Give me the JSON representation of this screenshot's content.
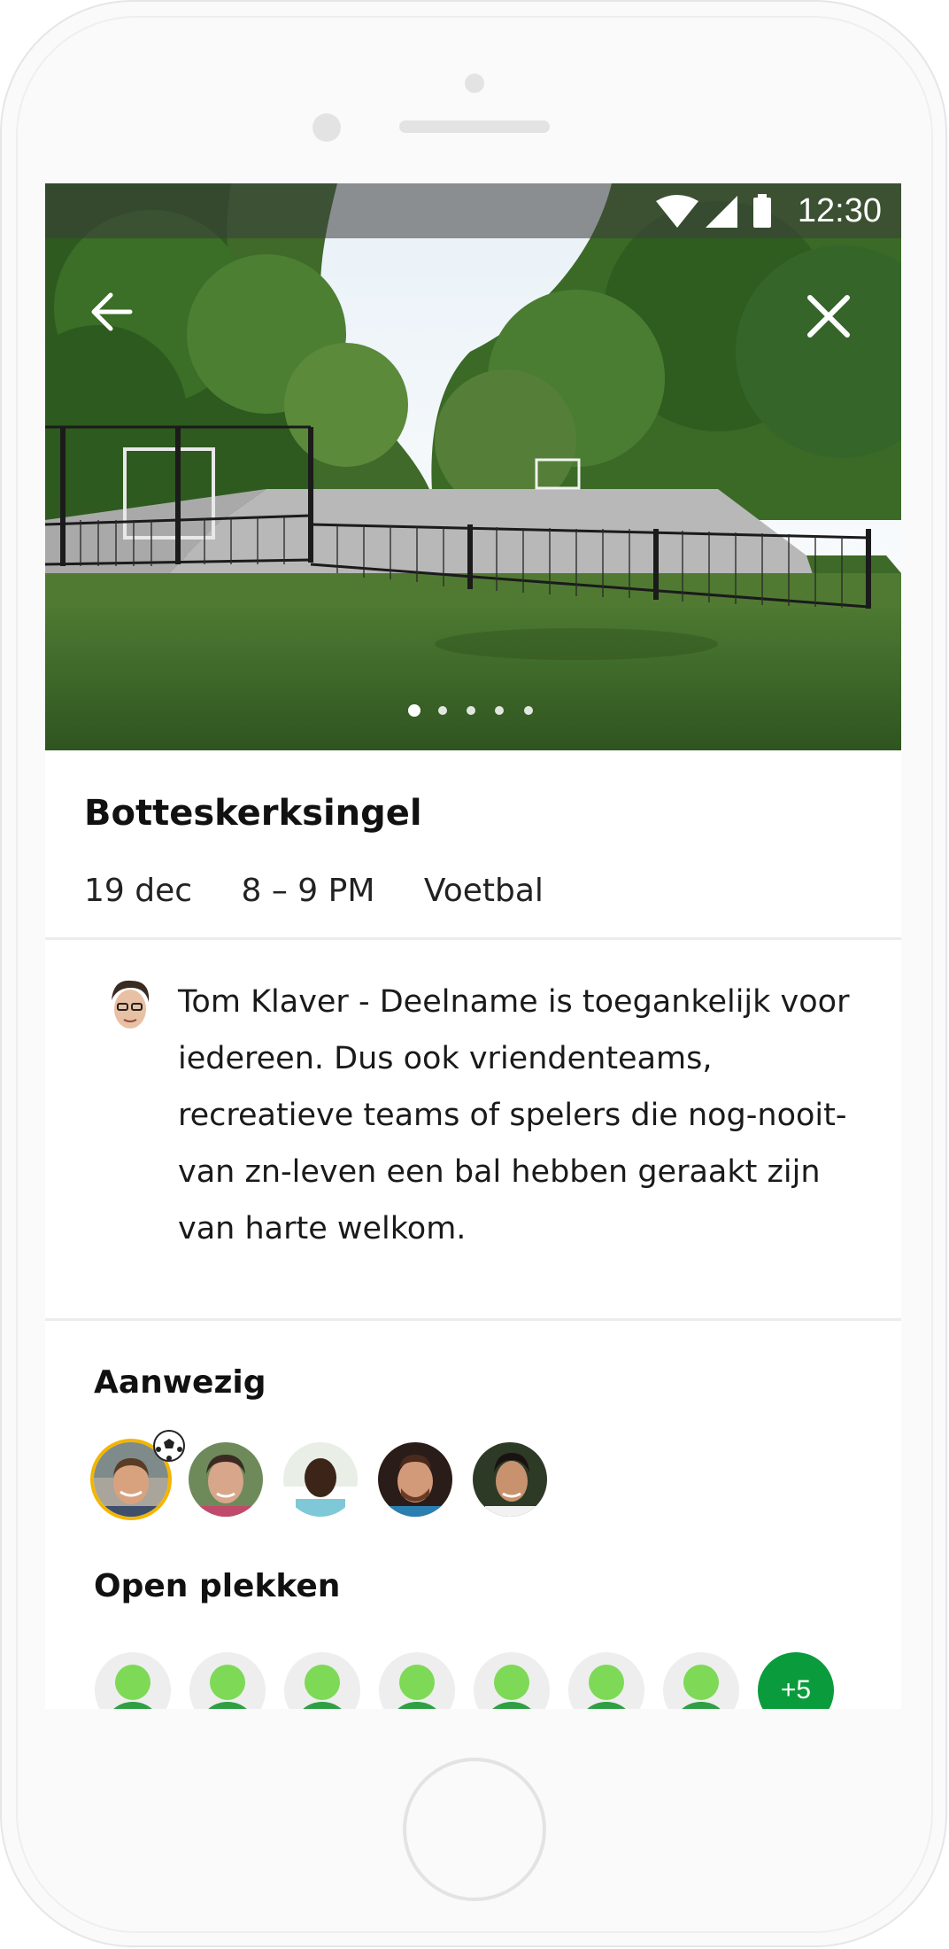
{
  "status_bar": {
    "time": "12:30",
    "icons": [
      "wifi-icon",
      "signal-icon",
      "battery-icon"
    ]
  },
  "hero": {
    "carousel_count": 5,
    "carousel_active": 1
  },
  "event": {
    "venue": "Botteskerksingel",
    "date": "19 dec",
    "time": "8 – 9 PM",
    "sport": "Voetbal"
  },
  "description": {
    "text": "Tom Klaver - Deelname is toegankelijk voor iedereen. Dus ook vriendenteams, recreatieve teams of spelers die nog-nooit-van zn-leven een bal hebben geraakt zijn van harte welkom."
  },
  "attendees": {
    "label": "Aanwezig",
    "count": 5
  },
  "open_spots": {
    "label": "Open plekken",
    "visible_slots": 7,
    "more": "+5"
  },
  "colors": {
    "accent_green": "#0a9c3c",
    "slot_green": "#7ed957",
    "highlight": "#f3b600"
  }
}
